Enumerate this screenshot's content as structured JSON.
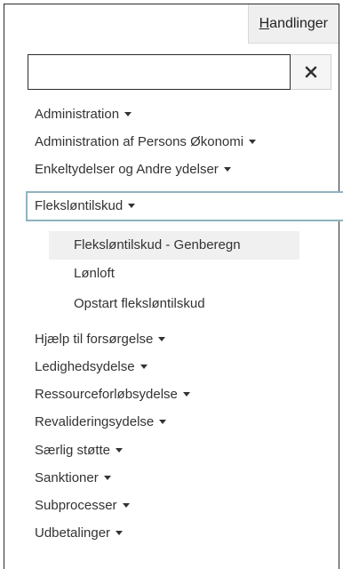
{
  "toolbar": {
    "actions_prefix": "H",
    "actions_rest": "andlinger"
  },
  "search": {
    "value": "",
    "placeholder": "",
    "clear_icon": "close-icon"
  },
  "menu": {
    "items": [
      {
        "label": "Administration"
      },
      {
        "label": "Administration af Persons Økonomi"
      },
      {
        "label": "Enkeltydelser og Andre ydelser"
      },
      {
        "label": "Fleksløntilskud",
        "expanded": true
      },
      {
        "label": "Hjælp til forsørgelse"
      },
      {
        "label": "Ledighedsydelse"
      },
      {
        "label": "Ressourceforløbsydelse"
      },
      {
        "label": "Revalideringsydelse"
      },
      {
        "label": "Særlig støtte"
      },
      {
        "label": "Sanktioner"
      },
      {
        "label": "Subprocesser"
      },
      {
        "label": "Udbetalinger"
      }
    ],
    "submenu": [
      {
        "label": "Fleksløntilskud - Genberegn",
        "highlighted": true
      },
      {
        "label": "Lønloft"
      },
      {
        "label": "Opstart fleksløntilskud"
      }
    ]
  },
  "colors": {
    "active_border": "#8fb3bf",
    "highlight_bg": "#f0f0f0",
    "text": "#333333"
  }
}
